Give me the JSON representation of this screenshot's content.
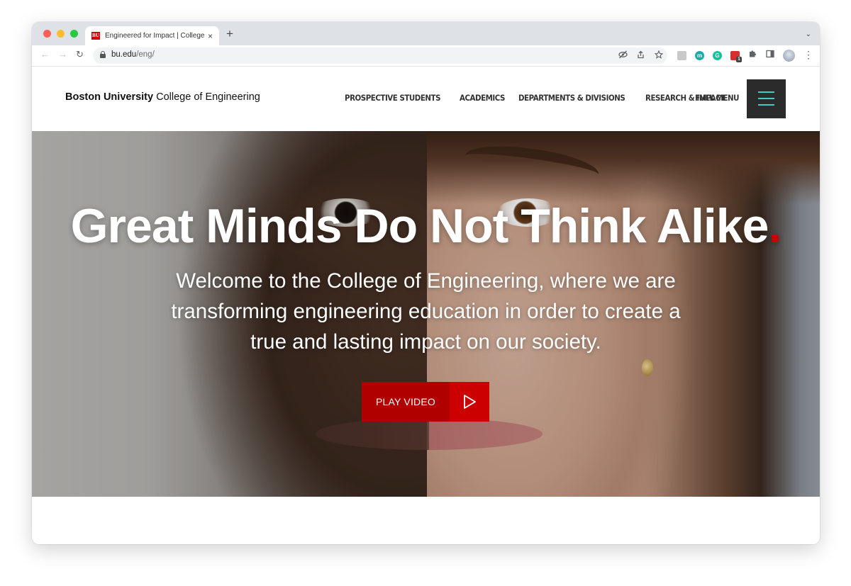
{
  "browser": {
    "tab": {
      "favicon_text": "BU",
      "title": "Engineered for Impact | College of Engineering",
      "close_icon": "×"
    },
    "new_tab_icon": "+",
    "tab_menu_icon": "⌄",
    "toolbar": {
      "back_icon": "←",
      "forward_icon": "→",
      "reload_icon": "↻",
      "url_host": "bu.edu",
      "url_path": "/eng/",
      "kebab_icon": "⋮"
    },
    "extensions": [
      {
        "name": "mastodon-extension-icon",
        "label": "m",
        "color": "#1fa9a5"
      },
      {
        "name": "grammarly-extension-icon",
        "label": "G",
        "color": "#15c39a"
      },
      {
        "name": "calendar-extension-icon",
        "label": "",
        "color": "#d32f2f",
        "badge": "1"
      }
    ]
  },
  "site": {
    "logo_bold": "Boston University",
    "logo_regular": " College of Engineering",
    "nav": [
      "PROSPECTIVE STUDENTS",
      "ACADEMICS",
      "DEPARTMENTS & DIVISIONS",
      "RESEARCH & IMPACT"
    ],
    "full_menu": "FULL MENU",
    "accent_color": "#cc0000",
    "menu_line_color": "#45c7c2"
  },
  "hero": {
    "title": "Great Minds Do Not Think Alike",
    "title_dot": ".",
    "subtitle": "Welcome to the College of Engineering, where we are transforming engineering education in order to create a true and lasting impact on our society.",
    "play_label": "PLAY VIDEO"
  }
}
